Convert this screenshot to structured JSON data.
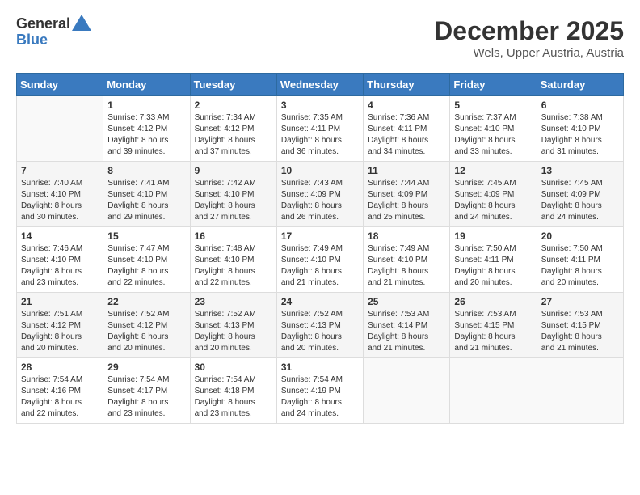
{
  "logo": {
    "general": "General",
    "blue": "Blue"
  },
  "header": {
    "month": "December 2025",
    "location": "Wels, Upper Austria, Austria"
  },
  "days_of_week": [
    "Sunday",
    "Monday",
    "Tuesday",
    "Wednesday",
    "Thursday",
    "Friday",
    "Saturday"
  ],
  "weeks": [
    [
      {
        "day": "",
        "info": ""
      },
      {
        "day": "1",
        "info": "Sunrise: 7:33 AM\nSunset: 4:12 PM\nDaylight: 8 hours\nand 39 minutes."
      },
      {
        "day": "2",
        "info": "Sunrise: 7:34 AM\nSunset: 4:12 PM\nDaylight: 8 hours\nand 37 minutes."
      },
      {
        "day": "3",
        "info": "Sunrise: 7:35 AM\nSunset: 4:11 PM\nDaylight: 8 hours\nand 36 minutes."
      },
      {
        "day": "4",
        "info": "Sunrise: 7:36 AM\nSunset: 4:11 PM\nDaylight: 8 hours\nand 34 minutes."
      },
      {
        "day": "5",
        "info": "Sunrise: 7:37 AM\nSunset: 4:10 PM\nDaylight: 8 hours\nand 33 minutes."
      },
      {
        "day": "6",
        "info": "Sunrise: 7:38 AM\nSunset: 4:10 PM\nDaylight: 8 hours\nand 31 minutes."
      }
    ],
    [
      {
        "day": "7",
        "info": "Sunrise: 7:40 AM\nSunset: 4:10 PM\nDaylight: 8 hours\nand 30 minutes."
      },
      {
        "day": "8",
        "info": "Sunrise: 7:41 AM\nSunset: 4:10 PM\nDaylight: 8 hours\nand 29 minutes."
      },
      {
        "day": "9",
        "info": "Sunrise: 7:42 AM\nSunset: 4:10 PM\nDaylight: 8 hours\nand 27 minutes."
      },
      {
        "day": "10",
        "info": "Sunrise: 7:43 AM\nSunset: 4:09 PM\nDaylight: 8 hours\nand 26 minutes."
      },
      {
        "day": "11",
        "info": "Sunrise: 7:44 AM\nSunset: 4:09 PM\nDaylight: 8 hours\nand 25 minutes."
      },
      {
        "day": "12",
        "info": "Sunrise: 7:45 AM\nSunset: 4:09 PM\nDaylight: 8 hours\nand 24 minutes."
      },
      {
        "day": "13",
        "info": "Sunrise: 7:45 AM\nSunset: 4:09 PM\nDaylight: 8 hours\nand 24 minutes."
      }
    ],
    [
      {
        "day": "14",
        "info": "Sunrise: 7:46 AM\nSunset: 4:10 PM\nDaylight: 8 hours\nand 23 minutes."
      },
      {
        "day": "15",
        "info": "Sunrise: 7:47 AM\nSunset: 4:10 PM\nDaylight: 8 hours\nand 22 minutes."
      },
      {
        "day": "16",
        "info": "Sunrise: 7:48 AM\nSunset: 4:10 PM\nDaylight: 8 hours\nand 22 minutes."
      },
      {
        "day": "17",
        "info": "Sunrise: 7:49 AM\nSunset: 4:10 PM\nDaylight: 8 hours\nand 21 minutes."
      },
      {
        "day": "18",
        "info": "Sunrise: 7:49 AM\nSunset: 4:10 PM\nDaylight: 8 hours\nand 21 minutes."
      },
      {
        "day": "19",
        "info": "Sunrise: 7:50 AM\nSunset: 4:11 PM\nDaylight: 8 hours\nand 20 minutes."
      },
      {
        "day": "20",
        "info": "Sunrise: 7:50 AM\nSunset: 4:11 PM\nDaylight: 8 hours\nand 20 minutes."
      }
    ],
    [
      {
        "day": "21",
        "info": "Sunrise: 7:51 AM\nSunset: 4:12 PM\nDaylight: 8 hours\nand 20 minutes."
      },
      {
        "day": "22",
        "info": "Sunrise: 7:52 AM\nSunset: 4:12 PM\nDaylight: 8 hours\nand 20 minutes."
      },
      {
        "day": "23",
        "info": "Sunrise: 7:52 AM\nSunset: 4:13 PM\nDaylight: 8 hours\nand 20 minutes."
      },
      {
        "day": "24",
        "info": "Sunrise: 7:52 AM\nSunset: 4:13 PM\nDaylight: 8 hours\nand 20 minutes."
      },
      {
        "day": "25",
        "info": "Sunrise: 7:53 AM\nSunset: 4:14 PM\nDaylight: 8 hours\nand 21 minutes."
      },
      {
        "day": "26",
        "info": "Sunrise: 7:53 AM\nSunset: 4:15 PM\nDaylight: 8 hours\nand 21 minutes."
      },
      {
        "day": "27",
        "info": "Sunrise: 7:53 AM\nSunset: 4:15 PM\nDaylight: 8 hours\nand 21 minutes."
      }
    ],
    [
      {
        "day": "28",
        "info": "Sunrise: 7:54 AM\nSunset: 4:16 PM\nDaylight: 8 hours\nand 22 minutes."
      },
      {
        "day": "29",
        "info": "Sunrise: 7:54 AM\nSunset: 4:17 PM\nDaylight: 8 hours\nand 23 minutes."
      },
      {
        "day": "30",
        "info": "Sunrise: 7:54 AM\nSunset: 4:18 PM\nDaylight: 8 hours\nand 23 minutes."
      },
      {
        "day": "31",
        "info": "Sunrise: 7:54 AM\nSunset: 4:19 PM\nDaylight: 8 hours\nand 24 minutes."
      },
      {
        "day": "",
        "info": ""
      },
      {
        "day": "",
        "info": ""
      },
      {
        "day": "",
        "info": ""
      }
    ]
  ]
}
